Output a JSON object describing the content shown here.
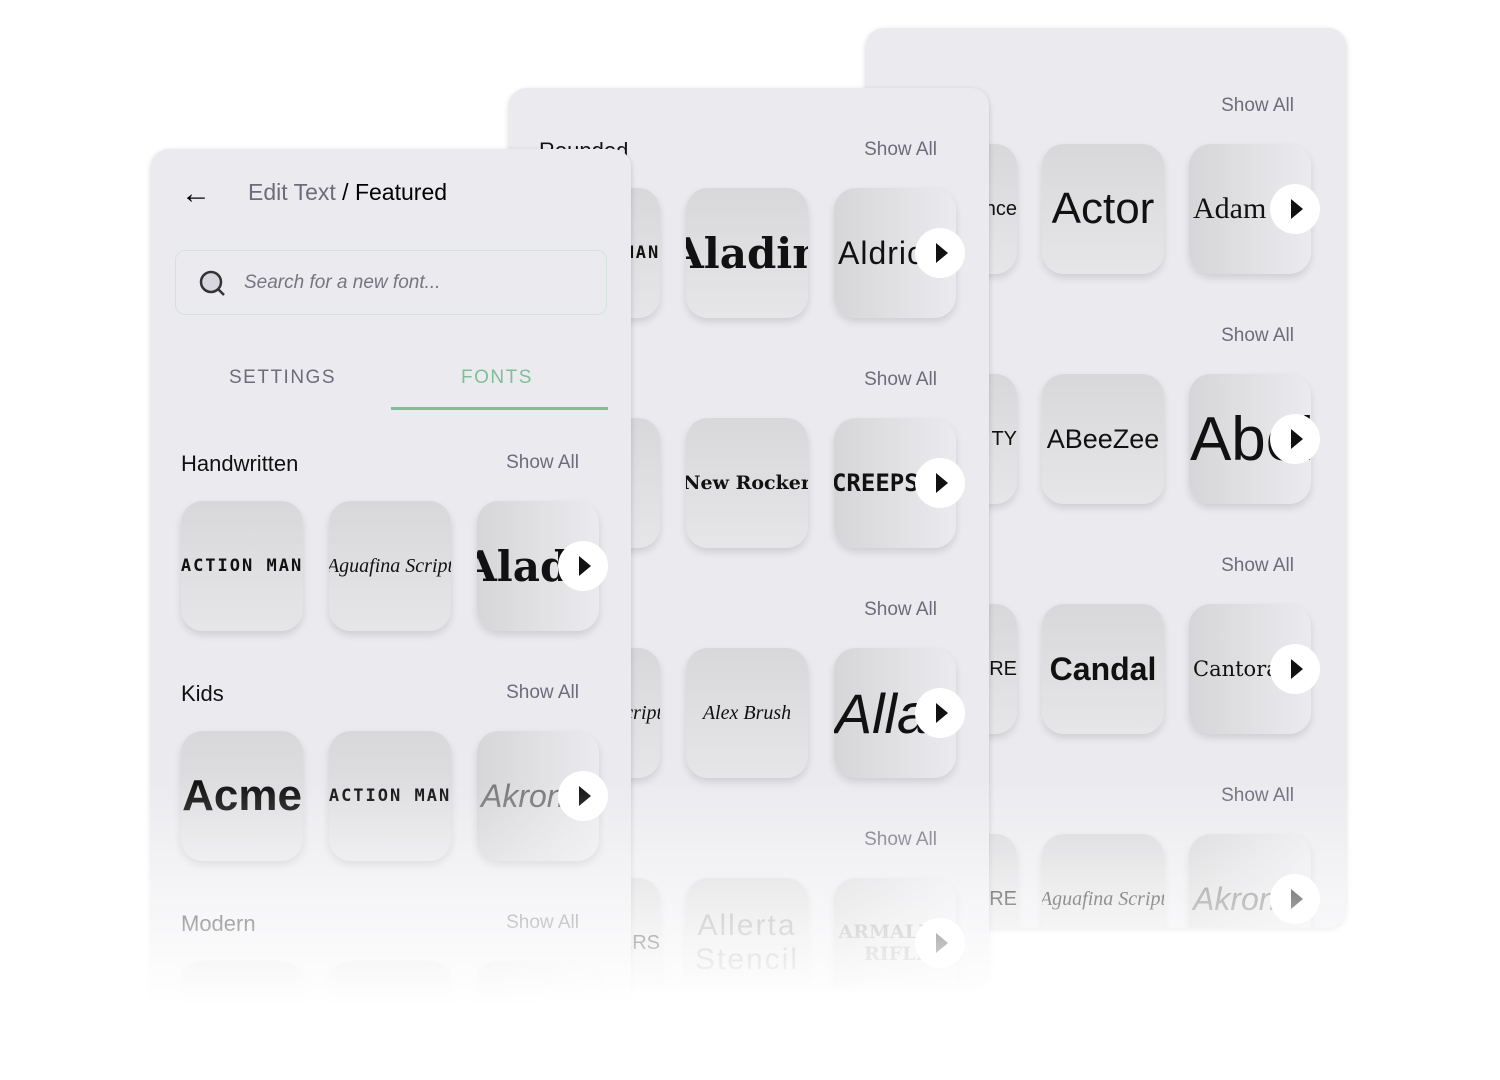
{
  "header": {
    "breadcrumb_parent": "Edit Text",
    "breadcrumb_sep": " / ",
    "breadcrumb_current": "Featured"
  },
  "search": {
    "placeholder": "Search for a new font..."
  },
  "tabs": [
    {
      "label": "SETTINGS",
      "active": false
    },
    {
      "label": "FONTS",
      "active": true
    }
  ],
  "colors": {
    "accent": "#7fbf98",
    "panel": "#ebebef"
  },
  "show_all": "Show All",
  "panels": [
    {
      "id": "p3",
      "sections": [
        {
          "title": "",
          "tiles": [
            "Romance",
            "Actor",
            "Adam"
          ]
        },
        {
          "title": "",
          "tiles": [
            "TY",
            "ABeeZee",
            "Abel"
          ]
        },
        {
          "title": "",
          "tiles": [
            "RE",
            "Candal",
            "Cantora"
          ]
        },
        {
          "title": "",
          "tiles": [
            "RE",
            "Aguafina Script",
            "Akronim"
          ]
        }
      ]
    },
    {
      "id": "p2",
      "sections": [
        {
          "title": "Rounded",
          "tiles": [
            "ACTION MAN",
            "Aladin",
            "Aldrich"
          ]
        },
        {
          "title": "",
          "tiles": [
            "",
            "New Rocker",
            "CREEPSTER"
          ]
        },
        {
          "title": "",
          "tiles": [
            "Aguafina Script",
            "Alex Brush",
            "Allan"
          ]
        },
        {
          "title": "",
          "tiles": [
            "CREEPERS",
            "Allerta Stencil",
            "ARMALITE RIFLE"
          ]
        }
      ]
    },
    {
      "id": "p1",
      "sections": [
        {
          "title": "Handwritten",
          "tiles": [
            "ACTION MAN",
            "Aguafina Script",
            "Aladin"
          ]
        },
        {
          "title": "Kids",
          "tiles": [
            "Acme",
            "ACTION MAN",
            "Akronim"
          ]
        },
        {
          "title": "Modern",
          "tiles": [
            "",
            "",
            ""
          ]
        }
      ]
    }
  ]
}
